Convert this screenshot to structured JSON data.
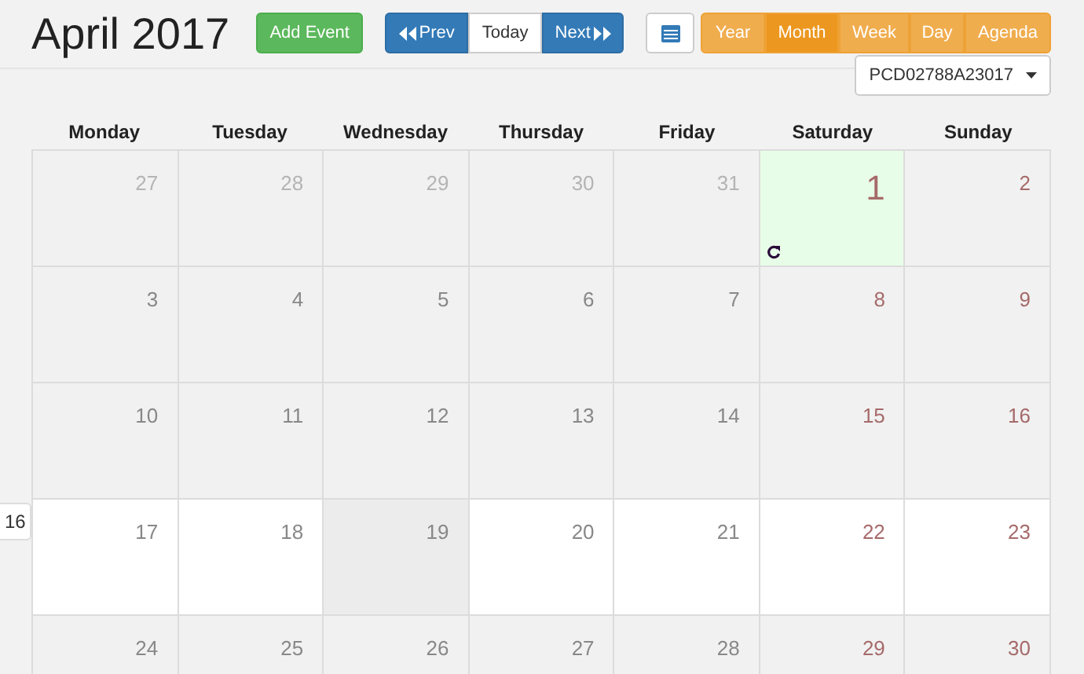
{
  "title": "April 2017",
  "add_event": "Add Event",
  "nav": [
    {
      "label": "Prev",
      "kind": "prev"
    },
    {
      "label": "Today",
      "kind": "today"
    },
    {
      "label": "Next",
      "kind": "next"
    }
  ],
  "views": [
    {
      "label": "Year",
      "selected": false
    },
    {
      "label": "Month",
      "selected": true
    },
    {
      "label": "Week",
      "selected": false
    },
    {
      "label": "Day",
      "selected": false
    },
    {
      "label": "Agenda",
      "selected": false
    }
  ],
  "device_dropdown": "PCD02788A23017",
  "weekdays": [
    "Monday",
    "Tuesday",
    "Wednesday",
    "Thursday",
    "Friday",
    "Saturday",
    "Sunday"
  ],
  "week_tab": "16",
  "weeks": [
    {
      "highlighted": false,
      "days": [
        {
          "label": "27",
          "kind": "other"
        },
        {
          "label": "28",
          "kind": "other"
        },
        {
          "label": "29",
          "kind": "other"
        },
        {
          "label": "30",
          "kind": "other"
        },
        {
          "label": "31",
          "kind": "other"
        },
        {
          "label": "1",
          "kind": "today",
          "event": true
        },
        {
          "label": "2",
          "kind": "weekend"
        }
      ]
    },
    {
      "highlighted": false,
      "days": [
        {
          "label": "3",
          "kind": "day"
        },
        {
          "label": "4",
          "kind": "day"
        },
        {
          "label": "5",
          "kind": "day"
        },
        {
          "label": "6",
          "kind": "day"
        },
        {
          "label": "7",
          "kind": "day"
        },
        {
          "label": "8",
          "kind": "weekend"
        },
        {
          "label": "9",
          "kind": "weekend"
        }
      ]
    },
    {
      "highlighted": false,
      "days": [
        {
          "label": "10",
          "kind": "day"
        },
        {
          "label": "11",
          "kind": "day"
        },
        {
          "label": "12",
          "kind": "day"
        },
        {
          "label": "13",
          "kind": "day"
        },
        {
          "label": "14",
          "kind": "day"
        },
        {
          "label": "15",
          "kind": "weekend"
        },
        {
          "label": "16",
          "kind": "weekend"
        }
      ]
    },
    {
      "highlighted": true,
      "days": [
        {
          "label": "17",
          "kind": "day"
        },
        {
          "label": "18",
          "kind": "day"
        },
        {
          "label": "19",
          "kind": "day",
          "hovered": true
        },
        {
          "label": "20",
          "kind": "day"
        },
        {
          "label": "21",
          "kind": "day"
        },
        {
          "label": "22",
          "kind": "weekend"
        },
        {
          "label": "23",
          "kind": "weekend"
        }
      ]
    },
    {
      "highlighted": false,
      "days": [
        {
          "label": "24",
          "kind": "day"
        },
        {
          "label": "25",
          "kind": "day"
        },
        {
          "label": "26",
          "kind": "day"
        },
        {
          "label": "27",
          "kind": "day"
        },
        {
          "label": "28",
          "kind": "day"
        },
        {
          "label": "29",
          "kind": "weekend"
        },
        {
          "label": "30",
          "kind": "weekend"
        }
      ]
    }
  ]
}
